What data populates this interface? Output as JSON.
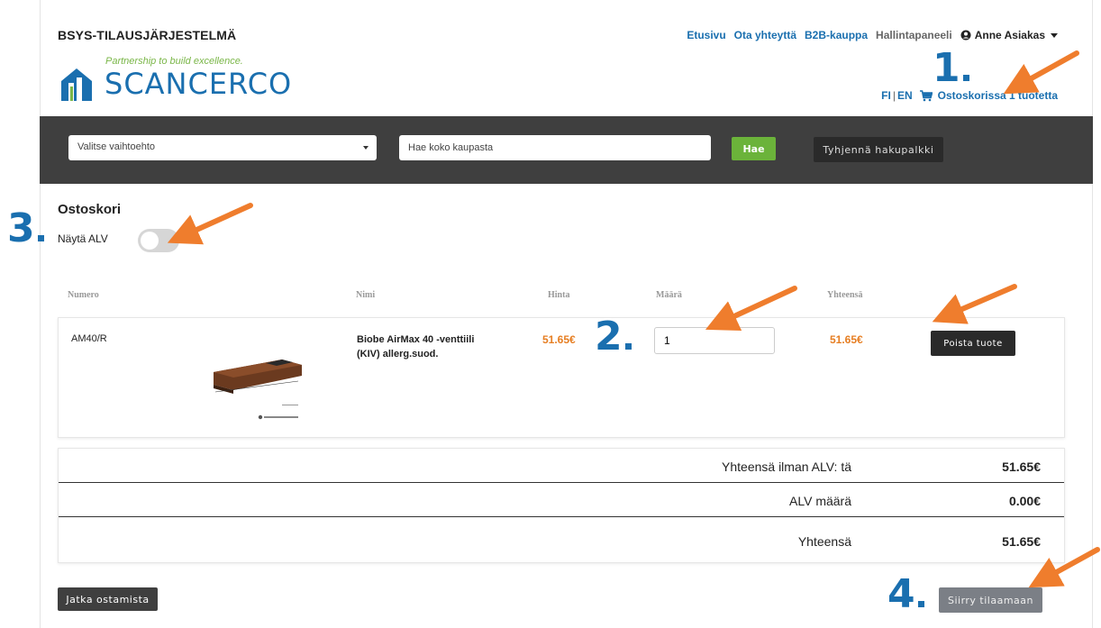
{
  "header": {
    "system_title": "BSYS-TILAUSJÄRJESTELMÄ",
    "logo_tagline": "Partnership to build excellence.",
    "logo_text": "SCANCERCO",
    "nav": [
      "Etusivu",
      "Ota yhteyttä",
      "B2B-kauppa"
    ],
    "admin_panel": "Hallintapaneeli",
    "user_name": "Anne Asiakas",
    "lang_fi": "FI",
    "lang_sep": "|",
    "lang_en": "EN",
    "cart_link": "Ostoskorissa 1 tuotetta"
  },
  "search": {
    "select_value": "Valitse vaihtoehto",
    "input_placeholder": "Hae koko kaupasta",
    "search_button": "Hae",
    "clear_button": "Tyhjennä hakupalkki"
  },
  "cart": {
    "title": "Ostoskori",
    "vat_toggle_label": "Näytä ALV",
    "vat_toggle_on": false,
    "columns": {
      "number": "Numero",
      "name": "Nimi",
      "price": "Hinta",
      "quantity": "Määrä",
      "total": "Yhteensä"
    },
    "items": [
      {
        "number": "AM40/R",
        "name": "Biobe AirMax 40 -venttiili (KIV) allerg.suod.",
        "price": "51.65€",
        "quantity": "1",
        "total": "51.65€",
        "remove_label": "Poista tuote"
      }
    ],
    "totals": [
      {
        "label": "Yhteensä ilman ALV: tä",
        "value": "51.65€"
      },
      {
        "label": "ALV määrä",
        "value": "0.00€"
      },
      {
        "label": "Yhteensä",
        "value": "51.65€"
      }
    ],
    "continue_button": "Jatka ostamista",
    "order_button": "Siirry tilaamaan"
  },
  "annotations": {
    "step1": "1",
    "step2": "2",
    "step3": "3",
    "step4": "4",
    "arrow_color": "#ef7d2d",
    "step_color": "#1a6faf"
  },
  "colors": {
    "accent_blue": "#1a6faf",
    "price_orange": "#e67e22",
    "search_green": "#6bb33a",
    "bar_dark": "#3f3f3f"
  }
}
